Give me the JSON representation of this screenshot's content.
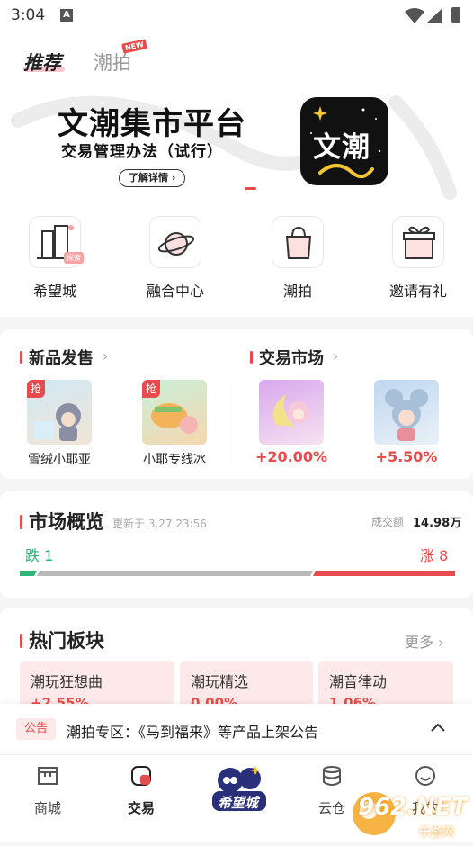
{
  "status_bar": {
    "time": "3:04",
    "notif_icon": "A"
  },
  "top_tabs": {
    "active": "推荐",
    "other": "潮拍",
    "new_badge": "NEW"
  },
  "banner": {
    "title": "文潮集市平台",
    "subtitle": "交易管理办法（试行）",
    "button": "了解详情",
    "logo_text": "文潮"
  },
  "quick_entries": [
    {
      "label": "希望城",
      "tag": "探索",
      "icon": "city-building-icon"
    },
    {
      "label": "融合中心",
      "icon": "planet-icon"
    },
    {
      "label": "潮拍",
      "icon": "shopping-bag-icon"
    },
    {
      "label": "邀请有礼",
      "icon": "gift-box-icon"
    }
  ],
  "new_release": {
    "title": "新品发售",
    "items": [
      {
        "label": "雪绒小耶亚",
        "tag": "抢"
      },
      {
        "label": "小耶专线冰",
        "tag": "抢"
      }
    ]
  },
  "trade_market": {
    "title": "交易市场",
    "items": [
      {
        "change": "+20.00%"
      },
      {
        "change": "+5.50%"
      }
    ]
  },
  "market_overview": {
    "title": "市场概览",
    "updated": "更新于 3.27 23:56",
    "volume_label": "成交额",
    "volume_value": "14.98万",
    "down_label": "跌 1",
    "up_label": "涨 8",
    "colors": {
      "down": "#2bb673",
      "flat": "#b9b9b9",
      "up": "#e84b4b"
    },
    "down_share": 0.04,
    "up_share": 0.32
  },
  "hot_sectors": {
    "title": "热门板块",
    "more": "更多",
    "cards": [
      {
        "name": "潮玩狂想曲",
        "value": "+2.55%"
      },
      {
        "name": "潮玩精选",
        "value": "0.00%"
      },
      {
        "name": "潮音律动",
        "value": "1.06%"
      }
    ]
  },
  "notice": {
    "tag": "公告",
    "text": "潮拍专区：《马到福来》等产品上架公告"
  },
  "bottom_nav": [
    {
      "label": "商城",
      "icon": "store-icon"
    },
    {
      "label": "交易",
      "icon": "trade-icon",
      "active": true
    },
    {
      "label": "希望城",
      "icon": "hope-city-logo-icon"
    },
    {
      "label": "云仓",
      "icon": "coins-stack-icon"
    },
    {
      "label": "我的",
      "icon": "smile-face-icon"
    }
  ],
  "watermark": {
    "text": "962.NET",
    "sub": "乐游网"
  },
  "accent": "#e84b4b"
}
